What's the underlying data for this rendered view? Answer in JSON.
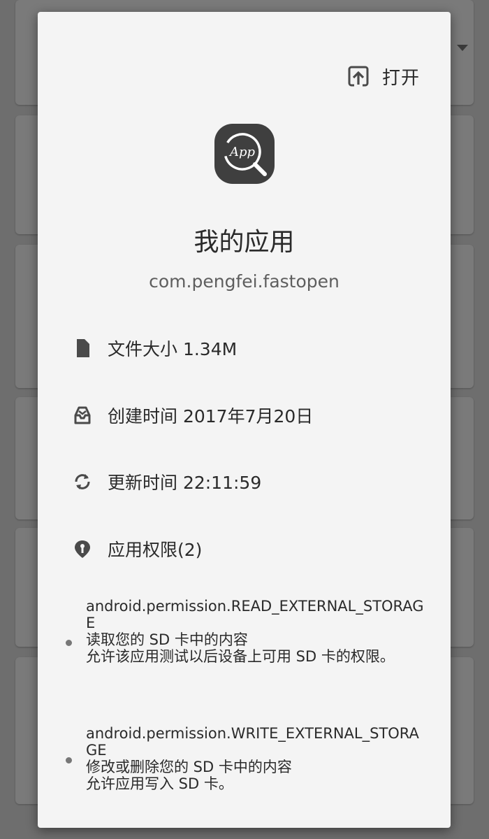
{
  "dialog": {
    "open_button": {
      "label": "打开",
      "icon": "open-in-icon"
    },
    "app": {
      "icon": "app-search-icon",
      "icon_text": "App",
      "name": "我的应用",
      "package": "com.pengfei.fastopen"
    },
    "info": {
      "file_size": {
        "icon": "file-icon",
        "text": "文件大小 1.34M"
      },
      "created": {
        "icon": "inbox-icon",
        "text": "创建时间 2017年7月20日"
      },
      "updated": {
        "icon": "sync-icon",
        "text": "更新时间 22:11:59"
      },
      "permissions": {
        "icon": "permission-pin-icon",
        "text": "应用权限(2)"
      }
    },
    "permission_list": [
      {
        "name": "android.permission.READ_EXTERNAL_STORAGE",
        "title": "读取您的 SD 卡中的内容",
        "description": "允许该应用测试以后设备上可用 SD 卡的权限。"
      },
      {
        "name": "android.permission.WRITE_EXTERNAL_STORAGE",
        "title": "修改或删除您的 SD 卡中的内容",
        "description": "允许应用写入 SD 卡。"
      }
    ]
  },
  "colors": {
    "dialog_background": "#f4f4f4",
    "scrim": "#6e6e6e",
    "icon": "#4a4a4a",
    "primary_text": "#2a2a2a",
    "secondary_text": "#5e5e5e"
  }
}
